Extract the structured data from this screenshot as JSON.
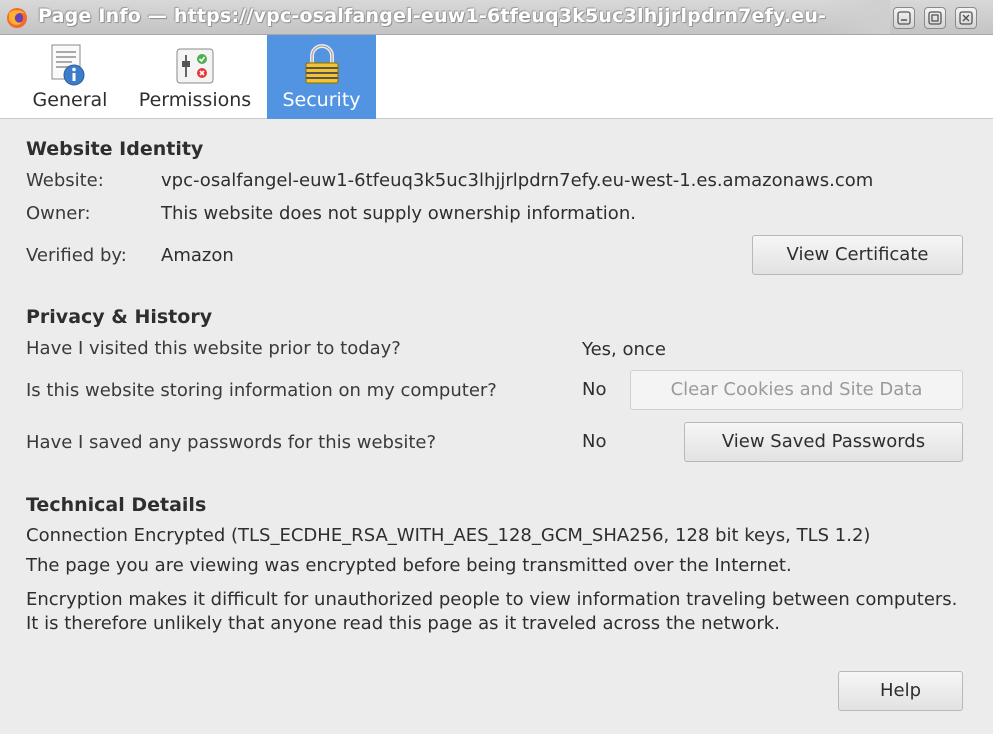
{
  "window": {
    "title": "Page Info — https://vpc-osalfangel-euw1-6tfeuq3k5uc3lhjjrlpdrn7efy.eu-"
  },
  "tabs": [
    {
      "label": "General",
      "icon": "info-page-icon",
      "selected": false
    },
    {
      "label": "Permissions",
      "icon": "permissions-toggle-icon",
      "selected": false
    },
    {
      "label": "Security",
      "icon": "padlock-icon",
      "selected": true
    }
  ],
  "identity": {
    "heading": "Website Identity",
    "website_label": "Website:",
    "website_value": "vpc-osalfangel-euw1-6tfeuq3k5uc3lhjjrlpdrn7efy.eu-west-1.es.amazonaws.com",
    "owner_label": "Owner:",
    "owner_value": "This website does not supply ownership information.",
    "verified_label": "Verified by:",
    "verified_value": "Amazon",
    "view_certificate_button": "View Certificate"
  },
  "privacy": {
    "heading": "Privacy & History",
    "visited_question": "Have I visited this website prior to today?",
    "visited_answer": "Yes, once",
    "storing_question": "Is this website storing information on my computer?",
    "storing_answer": "No",
    "clear_cookies_button": "Clear Cookies and Site Data",
    "passwords_question": "Have I saved any passwords for this website?",
    "passwords_answer": "No",
    "view_passwords_button": "View Saved Passwords"
  },
  "technical": {
    "heading": "Technical Details",
    "connection": "Connection Encrypted (TLS_ECDHE_RSA_WITH_AES_128_GCM_SHA256, 128 bit keys, TLS 1.2)",
    "summary": "The page you are viewing was encrypted before being transmitted over the Internet.",
    "explanation": "Encryption makes it difficult for unauthorized people to view information traveling between computers. It is therefore unlikely that anyone read this page as it traveled across the network."
  },
  "help_button": "Help",
  "colors": {
    "selected_tab": "#5294e2",
    "background": "#ececec"
  }
}
